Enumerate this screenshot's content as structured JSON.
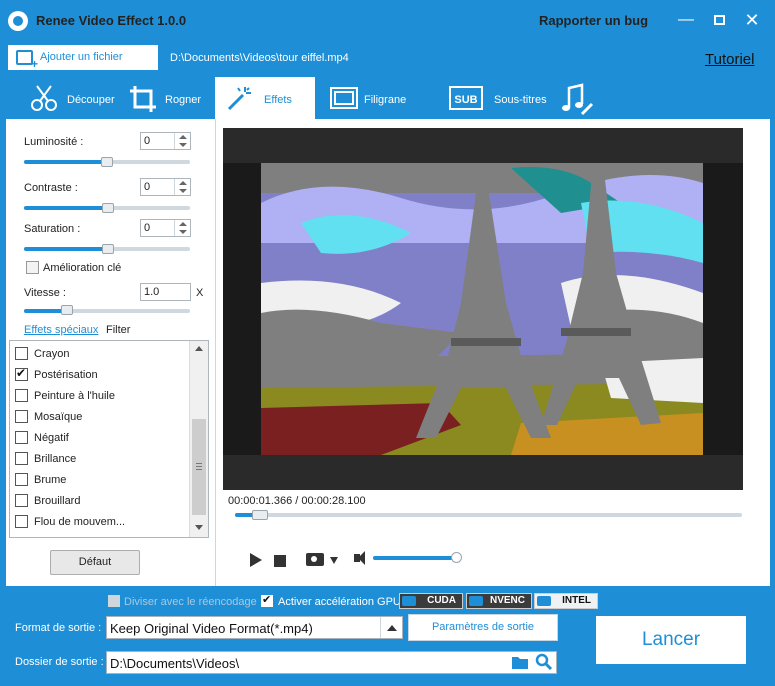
{
  "app": {
    "title": "Renee Video Effect 1.0.0",
    "report_bug": "Rapporter un bug",
    "minimize_icon": "minimize-icon",
    "maximize_icon": "maximize-icon",
    "close_icon": "close-icon"
  },
  "file_row": {
    "add_file_label": "Ajouter un fichier",
    "file_path": "D:\\Documents\\Videos\\tour eiffel.mp4",
    "tutorial_label": "Tutoriel"
  },
  "tabs": [
    {
      "label": "Découper",
      "icon": "scissors-icon",
      "active": false
    },
    {
      "label": "Rogner",
      "icon": "crop-icon",
      "active": false
    },
    {
      "label": "Effets",
      "icon": "magic-wand-icon",
      "active": true
    },
    {
      "label": "Filigrane",
      "icon": "watermark-icon",
      "active": false
    },
    {
      "label": "Sous-titres",
      "icon": "subtitle-icon",
      "active": false
    },
    {
      "label": "",
      "icon": "music-edit-icon",
      "active": false
    }
  ],
  "adjustments": {
    "brightness": {
      "label": "Luminosité :",
      "value": "0",
      "level_percent": 50
    },
    "contrast": {
      "label": "Contraste :",
      "value": "0",
      "level_percent": 50
    },
    "saturation": {
      "label": "Saturation :",
      "value": "0",
      "level_percent": 50
    },
    "key_enhancement": {
      "label": "Amélioration clé",
      "checked": false
    },
    "speed": {
      "label": "Vitesse :",
      "value": "1.0",
      "unit": "X",
      "level_percent": 25
    }
  },
  "effects": {
    "special_effects_tab": "Effets spéciaux",
    "filter_tab": "Filter",
    "items": [
      {
        "label": "Crayon",
        "checked": false
      },
      {
        "label": "Postérisation",
        "checked": true
      },
      {
        "label": "Peinture à l'huile",
        "checked": false
      },
      {
        "label": "Mosaïque",
        "checked": false
      },
      {
        "label": "Négatif",
        "checked": false
      },
      {
        "label": "Brillance",
        "checked": false
      },
      {
        "label": "Brume",
        "checked": false
      },
      {
        "label": "Brouillard",
        "checked": false
      },
      {
        "label": "Flou de mouvem...",
        "checked": false
      }
    ],
    "default_button": "Défaut"
  },
  "player": {
    "timecode": "00:00:01.366 / 00:00:28.100",
    "progress_fraction": 0.049,
    "volume_fraction": 0.95
  },
  "bottom": {
    "split_reencode_label": "Diviser avec le réencodage",
    "split_reencode_checked": false,
    "gpu_accel_label": "Activer accélération GPU",
    "gpu_accel_checked": true,
    "gpu_badges": [
      "CUDA",
      "NVENC",
      "INTEL"
    ],
    "output_format_label": "Format de sortie :",
    "output_format_value": "Keep Original Video Format(*.mp4)",
    "output_params_button": "Paramètres de sortie",
    "output_folder_label": "Dossier de sortie :",
    "output_folder_value": "D:\\Documents\\Videos\\",
    "launch_button": "Lancer"
  },
  "colors": {
    "accent": "#1e8fd6",
    "panel_bg": "#ffffff"
  }
}
